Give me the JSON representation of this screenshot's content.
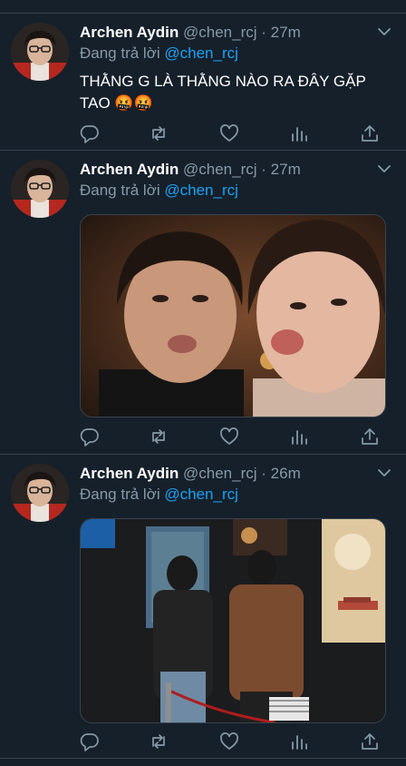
{
  "tweets": [
    {
      "display_name": "Archen Aydin",
      "handle": "@chen_rcj",
      "separator": "·",
      "time": "27m",
      "reply_prefix": "Đang trả lời",
      "reply_to": "@chen_rcj",
      "text": "THẰNG G LÀ THẰNG NÀO RA ĐÂY GẶP TAO 🤬🤬"
    },
    {
      "display_name": "Archen Aydin",
      "handle": "@chen_rcj",
      "separator": "·",
      "time": "27m",
      "reply_prefix": "Đang trả lời",
      "reply_to": "@chen_rcj"
    },
    {
      "display_name": "Archen Aydin",
      "handle": "@chen_rcj",
      "separator": "·",
      "time": "26m",
      "reply_prefix": "Đang trả lời",
      "reply_to": "@chen_rcj"
    }
  ],
  "colors": {
    "background": "#15202b",
    "divider": "#38444d",
    "secondary_text": "#8899a6",
    "accent": "#1da1f2"
  },
  "icons": [
    "more-icon",
    "reply-icon",
    "retweet-icon",
    "like-icon",
    "analytics-icon",
    "share-icon"
  ]
}
